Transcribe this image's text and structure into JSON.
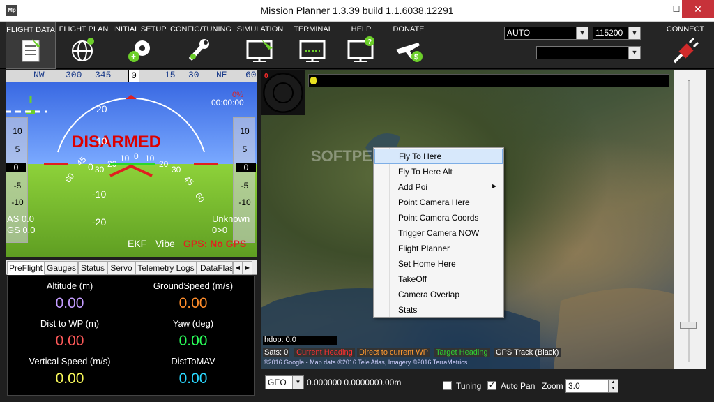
{
  "window": {
    "title": "Mission Planner 1.3.39 build 1.1.6038.12291",
    "icon_text": "Mp",
    "min": "—",
    "max": "☐",
    "close": "✕"
  },
  "menu": [
    {
      "label": "FLIGHT DATA",
      "icon": "flight-data-icon"
    },
    {
      "label": "FLIGHT PLAN",
      "icon": "globe-icon"
    },
    {
      "label": "INITIAL SETUP",
      "icon": "gears-icon"
    },
    {
      "label": "CONFIG/TUNING",
      "icon": "wrench-icon"
    },
    {
      "label": "SIMULATION",
      "icon": "monitor-plane-icon"
    },
    {
      "label": "TERMINAL",
      "icon": "monitor-icon"
    },
    {
      "label": "HELP",
      "icon": "monitor-help-icon"
    },
    {
      "label": "DONATE",
      "icon": "plane-dollar-icon"
    }
  ],
  "connect": {
    "mode": "AUTO",
    "baud": "115200",
    "port": "",
    "label": "CONNECT"
  },
  "hud": {
    "heading_ticks": [
      "NW",
      "300",
      "345",
      "0",
      "15",
      "30",
      "NE",
      "60"
    ],
    "heading_value": "0",
    "roll_ticks": [
      "60",
      "45",
      "30",
      "20",
      "10",
      "0",
      "10",
      "20",
      "30",
      "45",
      "60"
    ],
    "disarmed": "DISARMED",
    "battery": "0%",
    "time": "00:00:00",
    "left_tape": [
      "10",
      "5",
      "0",
      "-5",
      "-10"
    ],
    "right_tape": [
      "10",
      "5",
      "0",
      "-5",
      "-10"
    ],
    "pitch": [
      "20",
      "10",
      "0",
      "-10",
      "-20"
    ],
    "as": "AS 0.0",
    "gs": "GS 0.0",
    "mode": "Unknown",
    "wp": "0>0",
    "ekf": "EKF",
    "vibe": "Vibe",
    "gps": "GPS: No GPS"
  },
  "tabs": [
    "PreFlight",
    "Gauges",
    "Status",
    "Servo",
    "Telemetry Logs",
    "DataFlash"
  ],
  "quick": [
    {
      "label": "Altitude (m)",
      "value": "0.00",
      "color": "#c49cff"
    },
    {
      "label": "GroundSpeed (m/s)",
      "value": "0.00",
      "color": "#ff8c2a"
    },
    {
      "label": "Dist to WP (m)",
      "value": "0.00",
      "color": "#ff5a5a"
    },
    {
      "label": "Yaw (deg)",
      "value": "0.00",
      "color": "#2aff5a"
    },
    {
      "label": "Vertical Speed (m/s)",
      "value": "0.00",
      "color": "#f8f85a"
    },
    {
      "label": "DistToMAV",
      "value": "0.00",
      "color": "#2ad8ff"
    }
  ],
  "map": {
    "marker": "0",
    "hdop": "hdop: 0.0",
    "sats": "Sats: 0",
    "legend": [
      {
        "text": "Current Heading",
        "color": "#ff3030"
      },
      {
        "text": "Direct to current WP",
        "color": "#ff9a30"
      },
      {
        "text": "Target Heading",
        "color": "#30d030"
      },
      {
        "text": "GPS Track (Black)",
        "color": "#ffffff"
      }
    ],
    "copyright": "©2016 Google - Map data ©2016 Tele Atlas, Imagery ©2016 TerraMetrics",
    "watermark": "SOFTPEDIA"
  },
  "context_menu": [
    "Fly To Here",
    "Fly To Here Alt",
    "Add Poi",
    "Point Camera Here",
    "Point Camera Coords",
    "Trigger Camera NOW",
    "Flight Planner",
    "Set Home Here",
    "TakeOff",
    "Camera Overlap",
    "Stats"
  ],
  "bottom": {
    "coord_system": "GEO",
    "coords": "0.000000 0.000000",
    "alt": "0.00m",
    "tuning": "Tuning",
    "auto_pan": "Auto Pan",
    "zoom_label": "Zoom",
    "zoom_value": "3.0"
  }
}
